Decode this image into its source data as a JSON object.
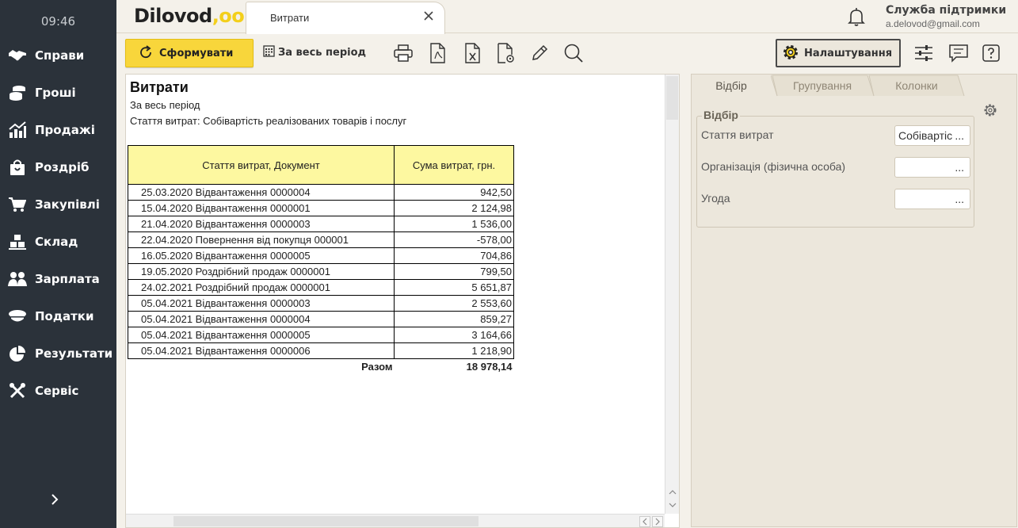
{
  "sidebar": {
    "time": "09:46",
    "items": [
      {
        "label": "Справи",
        "icon": "handshake-icon"
      },
      {
        "label": "Гроші",
        "icon": "coins-icon"
      },
      {
        "label": "Продажі",
        "icon": "chart-up-icon"
      },
      {
        "label": "Роздріб",
        "icon": "shopping-bag-icon"
      },
      {
        "label": "Закупівлі",
        "icon": "cart-icon"
      },
      {
        "label": "Склад",
        "icon": "boxes-icon"
      },
      {
        "label": "Зарплата",
        "icon": "people-icon"
      },
      {
        "label": "Податки",
        "icon": "officer-cap-icon"
      },
      {
        "label": "Результати",
        "icon": "pie-chart-icon"
      },
      {
        "label": "Сервіс",
        "icon": "tools-icon"
      }
    ],
    "expand_icon": "chevron-right-icon"
  },
  "header": {
    "logo_text": "Dilovod",
    "logo_dots": ",oo",
    "tab_title": "Витрати",
    "support_name": "Служба підтримки",
    "support_email": "a.delovod@gmail.com"
  },
  "toolbar": {
    "form_label": "Сформувати",
    "period_label": "За весь період",
    "settings_label": "Налаштування"
  },
  "report": {
    "title": "Витрати",
    "period": "За весь період",
    "filter_line": "Стаття витрат:  Собівартість реалізованих товарів і послуг",
    "columns": [
      "Стаття витрат, Документ",
      "Сума витрат, грн."
    ],
    "rows": [
      [
        "25.03.2020 Відвантаження 0000004",
        "942,50"
      ],
      [
        "15.04.2020 Відвантаження 0000001",
        "2 124,98"
      ],
      [
        "21.04.2020 Відвантаження 0000003",
        "1 536,00"
      ],
      [
        "22.04.2020 Повернення від покупця 000001",
        "-578,00"
      ],
      [
        "16.05.2020 Відвантаження 0000005",
        "704,86"
      ],
      [
        "19.05.2020 Роздрібний продаж 0000001",
        "799,50"
      ],
      [
        "24.02.2021 Роздрібний продаж 0000001",
        "5 651,87"
      ],
      [
        "05.04.2021 Відвантаження 0000003",
        "2 553,60"
      ],
      [
        "05.04.2021 Відвантаження 0000004",
        "859,27"
      ],
      [
        "05.04.2021 Відвантаження 0000005",
        "3 164,66"
      ],
      [
        "05.04.2021 Відвантаження 0000006",
        "1 218,90"
      ]
    ],
    "total_label": "Разом",
    "total_value": "18 978,14"
  },
  "panel": {
    "tabs": [
      "Відбір",
      "Групування",
      "Колонки"
    ],
    "group_title": "Відбір",
    "filters": [
      {
        "label": "Стаття витрат",
        "value": "Собівартіс"
      },
      {
        "label": "Організація (фізична особа)",
        "value": ""
      },
      {
        "label": "Угода",
        "value": ""
      }
    ],
    "dots": "..."
  }
}
